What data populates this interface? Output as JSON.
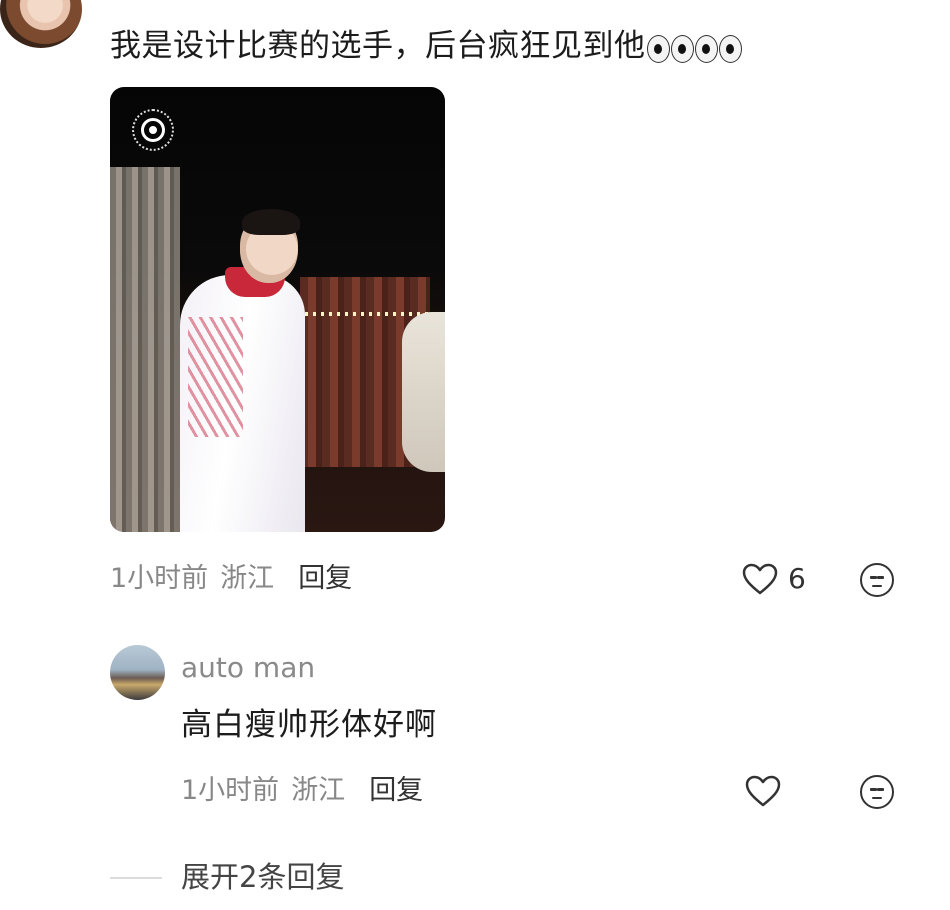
{
  "comment": {
    "text": "我是设计比赛的选手，后台疯狂见到他",
    "emoji": "eyes-emoji x4",
    "time": "1小时前",
    "location": "浙江",
    "reply_label": "回复",
    "like_count": "6"
  },
  "reply": {
    "username": "auto man",
    "text": "高白瘦帅形体好啊",
    "time": "1小时前",
    "location": "浙江",
    "reply_label": "回复"
  },
  "expand": {
    "label": "展开2条回复"
  }
}
